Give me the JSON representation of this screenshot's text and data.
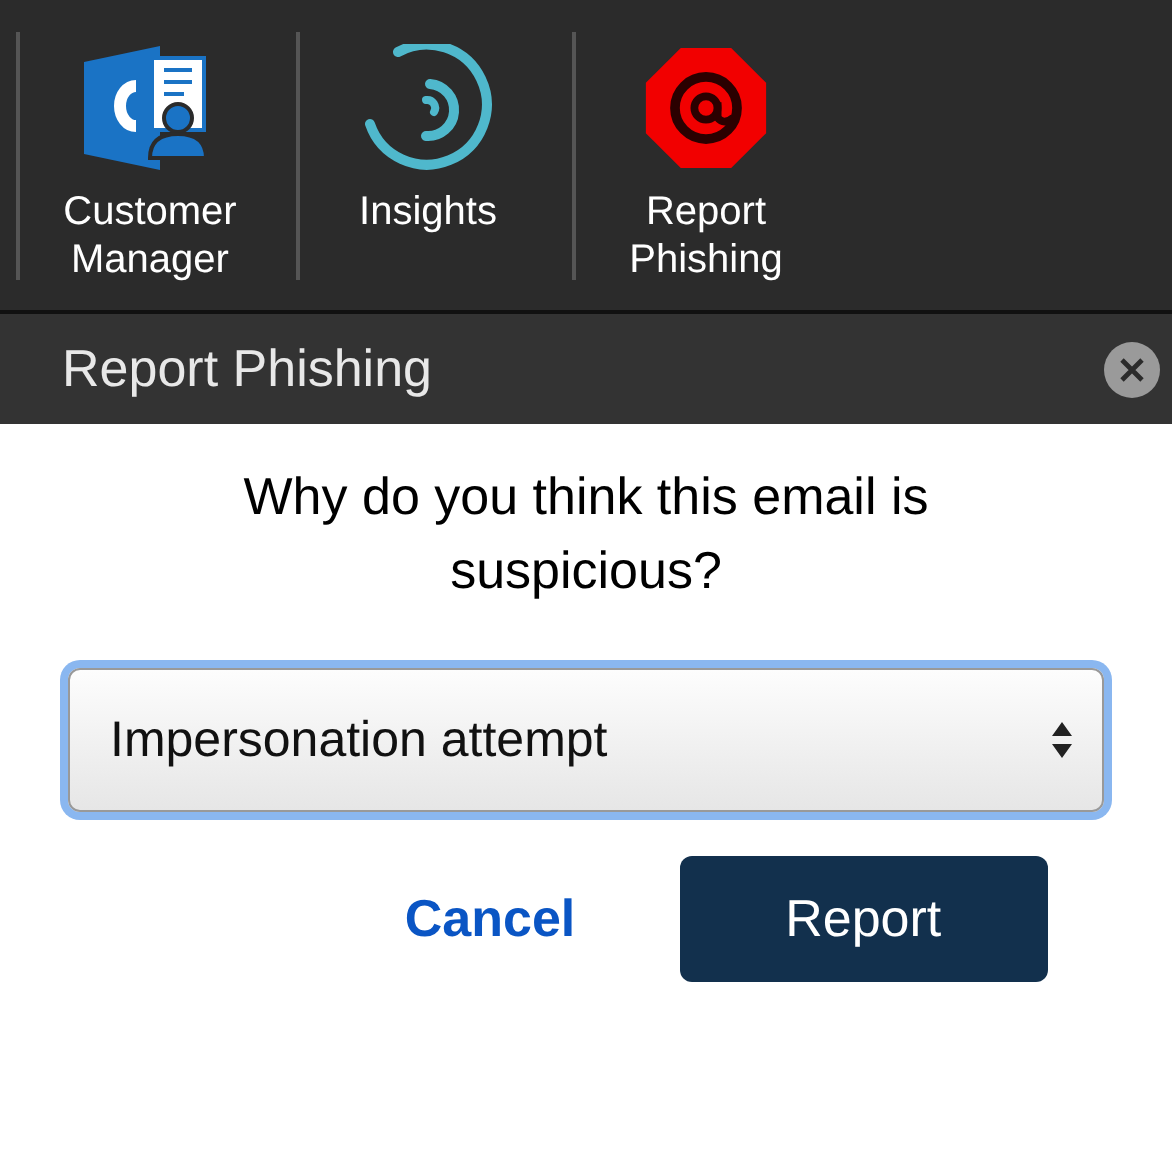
{
  "ribbon": {
    "buttons": [
      {
        "kind": "customer",
        "label": [
          "Customer",
          "Manager"
        ]
      },
      {
        "kind": "insights",
        "label": [
          "Insights"
        ]
      },
      {
        "kind": "phishing",
        "label": [
          "Report",
          "Phishing"
        ]
      }
    ]
  },
  "pane": {
    "title": "Report Phishing"
  },
  "dialog": {
    "question": "Why do you think this email is suspicious?",
    "select": {
      "value": "Impersonation attempt",
      "focused": true
    },
    "cancel": "Cancel",
    "submit": "Report"
  }
}
